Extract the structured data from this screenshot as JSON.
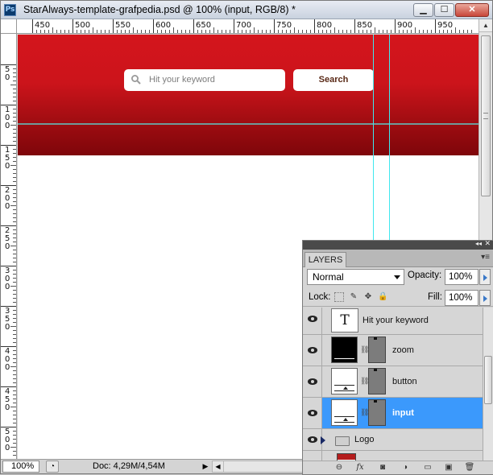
{
  "app": {
    "icon_label": "Ps",
    "document_title": "StarAlways-template-grafpedia.psd @ 100% (input, RGB/8) *"
  },
  "window_controls": {
    "minimize": "▁",
    "maximize": "☐",
    "close": "✕"
  },
  "ruler_h": {
    "labels": [
      "450",
      "500",
      "550",
      "600",
      "650",
      "700",
      "750",
      "800",
      "850",
      "900",
      "950"
    ]
  },
  "ruler_v": {
    "labels": [
      "50",
      "100",
      "150",
      "200",
      "250",
      "300",
      "350",
      "400",
      "450",
      "500"
    ]
  },
  "canvas": {
    "header_color_top": "#d4151c",
    "header_color_bottom": "#7e060a",
    "search_placeholder": "Hit your keyword",
    "search_button_label": "Search",
    "guide_color": "#3fe8ef"
  },
  "status": {
    "zoom": "100%",
    "doc_info": "Doc: 4,29M/4,54M"
  },
  "layers_panel": {
    "tab_label": "LAYERS",
    "blend_mode": "Normal",
    "opacity_label": "Opacity:",
    "opacity_value": "100%",
    "lock_label": "Lock:",
    "fill_label": "Fill:",
    "fill_value": "100%",
    "layers": [
      {
        "name": "Hit your keyword",
        "kind": "text",
        "text_glyph": "T",
        "visible": true,
        "selected": false
      },
      {
        "name": "zoom",
        "kind": "shape",
        "visible": true,
        "selected": false
      },
      {
        "name": "button",
        "kind": "shape",
        "visible": true,
        "selected": false
      },
      {
        "name": "input",
        "kind": "shape",
        "visible": true,
        "selected": true
      },
      {
        "name": "Logo",
        "kind": "group",
        "visible": true,
        "selected": false
      }
    ],
    "selected_color": "#3b99fc",
    "footer_icons": [
      "link-icon",
      "fx-icon",
      "mask-icon",
      "adjustment-icon",
      "group-icon",
      "new-layer-icon",
      "trash-icon"
    ],
    "footer_glyphs": {
      "link": "⊖",
      "fx": "fx",
      "mask": "◙",
      "adjust": "◑",
      "group": "▭",
      "new": "▣",
      "trash": "🗑"
    }
  }
}
